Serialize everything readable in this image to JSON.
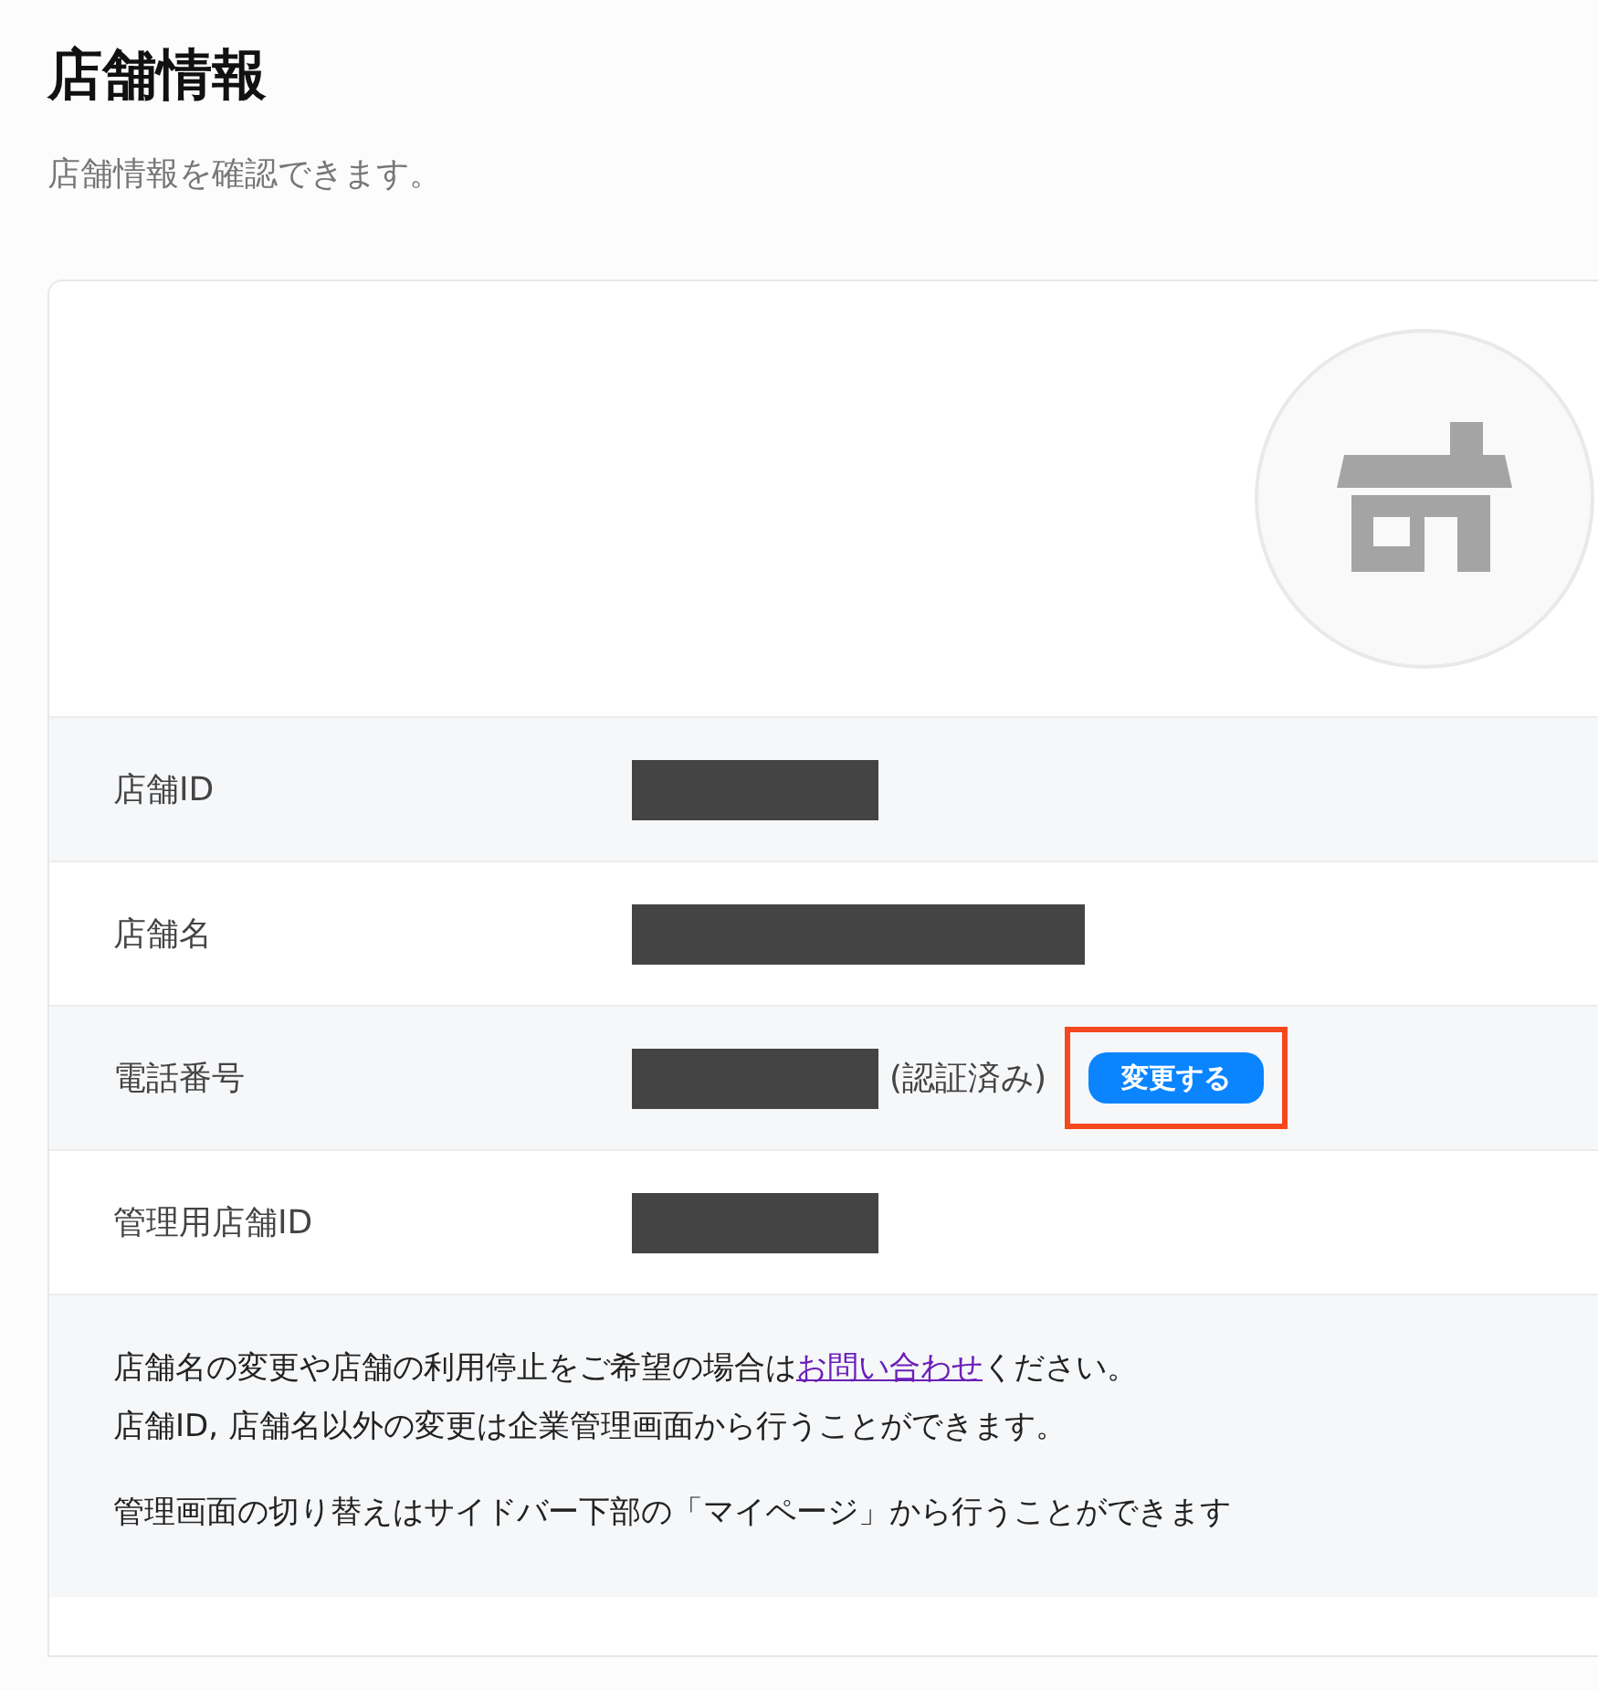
{
  "page": {
    "title": "店舗情報",
    "subtitle": "店舗情報を確認できます。"
  },
  "card": {
    "avatar": {
      "kind": "store"
    },
    "rows": [
      {
        "label": "店舗ID",
        "redacted": true
      },
      {
        "label": "店舗名",
        "redacted": true
      },
      {
        "label": "電話番号",
        "redacted": true,
        "note": "(認証済み)",
        "button": {
          "label": "変更する",
          "highlighted": true
        }
      },
      {
        "label": "管理用店舗ID",
        "redacted": true
      }
    ],
    "notice": {
      "lines": [
        [
          {
            "text": "店舗名の変更や店舗の利用停止をご希望の場合は"
          },
          {
            "text": "お問い合わせ",
            "link": true
          },
          {
            "text": "ください。"
          }
        ],
        [
          {
            "text": "店舗ID, 店舗名以外の変更は企業管理画面から行うことができます。"
          }
        ],
        [
          {
            "text": "管理画面の切り替えはサイドバー下部の「マイページ」から行うことができます"
          }
        ]
      ]
    }
  }
}
